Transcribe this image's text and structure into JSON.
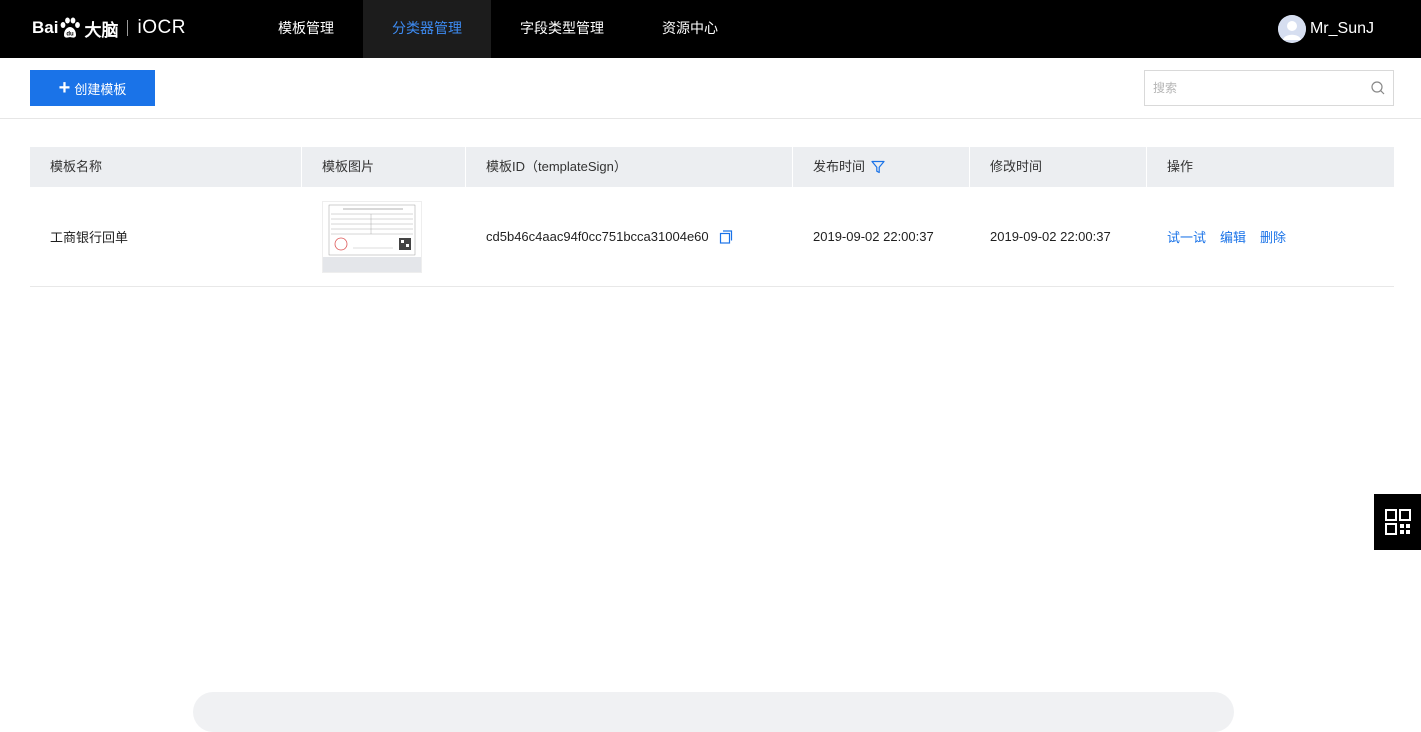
{
  "header": {
    "brand": "Bai",
    "brand_suffix": "大脑",
    "product": "iOCR",
    "nav": [
      {
        "label": "模板管理",
        "active": false
      },
      {
        "label": "分类器管理",
        "active": true
      },
      {
        "label": "字段类型管理",
        "active": false
      },
      {
        "label": "资源中心",
        "active": false
      }
    ],
    "username": "Mr_SunJ"
  },
  "toolbar": {
    "create_label": "创建模板",
    "search_placeholder": "搜索"
  },
  "table": {
    "columns": [
      "模板名称",
      "模板图片",
      "模板ID（templateSign）",
      "发布时间",
      "修改时间",
      "操作"
    ],
    "rows": [
      {
        "name": "工商银行回单",
        "template_id": "cd5b46c4aac94f0cc751bcca31004e60",
        "published": "2019-09-02 22:00:37",
        "modified": "2019-09-02 22:00:37",
        "actions": [
          "试一试",
          "编辑",
          "删除"
        ]
      }
    ]
  },
  "colors": {
    "accent": "#1a73e8",
    "nav_active": "#3d8bf2",
    "navbar_bg": "#000000",
    "header_row_bg": "#eceef1"
  },
  "icons": [
    "paw-icon",
    "avatar-icon",
    "plus-icon",
    "search-icon",
    "filter-icon",
    "copy-icon",
    "qr-code-icon"
  ]
}
